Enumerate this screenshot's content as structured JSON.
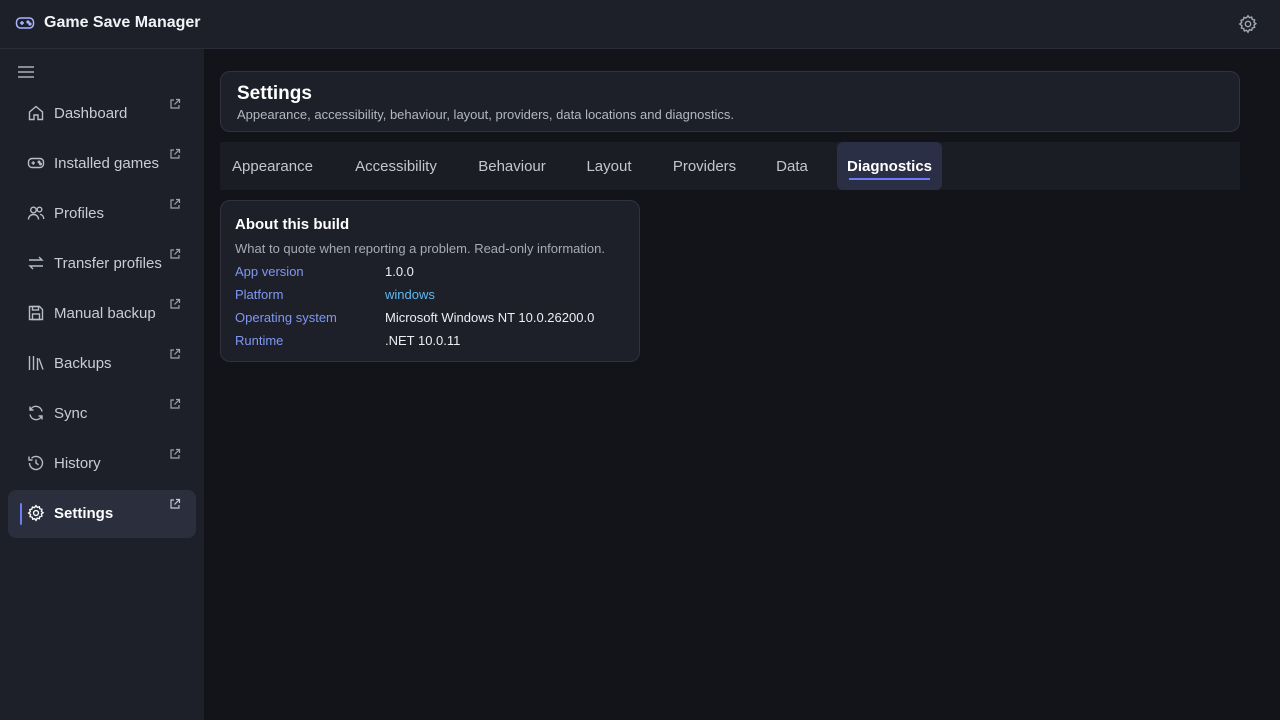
{
  "app": {
    "title": "Game Save Manager",
    "icon": "gamepad-icon"
  },
  "sidebar": {
    "items": [
      {
        "label": "Dashboard",
        "icon": "home-icon"
      },
      {
        "label": "Installed games",
        "icon": "gamepad-icon"
      },
      {
        "label": "Profiles",
        "icon": "users-icon"
      },
      {
        "label": "Transfer profiles",
        "icon": "transfer-icon"
      },
      {
        "label": "Manual backup",
        "icon": "save-icon"
      },
      {
        "label": "Backups",
        "icon": "library-icon"
      },
      {
        "label": "Sync",
        "icon": "sync-icon"
      },
      {
        "label": "History",
        "icon": "history-icon"
      },
      {
        "label": "Settings",
        "icon": "gear-icon",
        "active": true
      }
    ]
  },
  "header": {
    "title": "Settings",
    "subtitle": "Appearance, accessibility, behaviour, layout, providers, data locations and diagnostics."
  },
  "tabs": [
    {
      "label": "Appearance"
    },
    {
      "label": "Accessibility"
    },
    {
      "label": "Behaviour"
    },
    {
      "label": "Layout"
    },
    {
      "label": "Providers"
    },
    {
      "label": "Data"
    },
    {
      "label": "Diagnostics",
      "active": true
    }
  ],
  "about": {
    "title": "About this build",
    "description": "What to quote when reporting a problem. Read-only information.",
    "rows": [
      {
        "key": "App version",
        "value": "1.0.0"
      },
      {
        "key": "Platform",
        "value": "windows"
      },
      {
        "key": "Operating system",
        "value": "Microsoft Windows NT 10.0.26200.0"
      },
      {
        "key": "Runtime",
        "value": ".NET 10.0.11"
      }
    ]
  },
  "colors": {
    "accent": "#6b7cf6",
    "background": "#131419",
    "panel": "#1d2029",
    "link": "#5eb8f0",
    "key": "#7f98f2"
  }
}
